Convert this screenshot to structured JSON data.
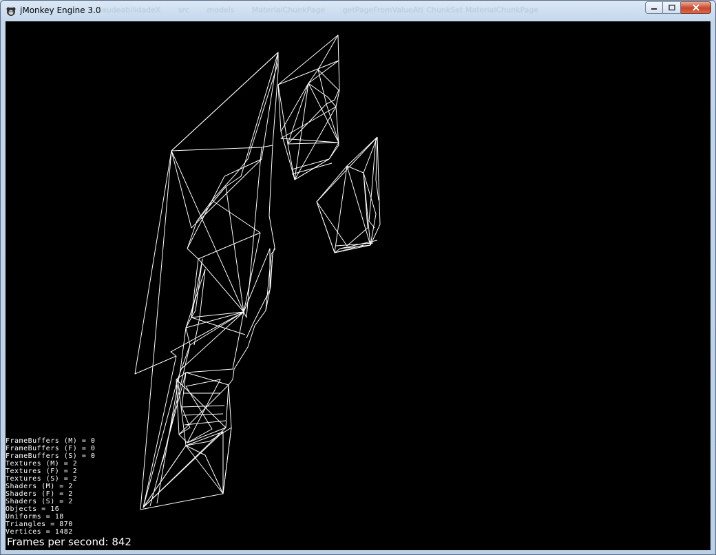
{
  "window": {
    "title": "jMonkey Engine 3.0",
    "app_icon": "jmonkey-icon",
    "background_breadcrumbs": [
      "SaudeabilidadeX",
      "src",
      "models",
      "MaterialChunkPage",
      "getPageFromValueAt( ChunkSet MaterialChunkPage"
    ],
    "controls": {
      "minimize_icon": "minimize-icon",
      "maximize_icon": "maximize-icon",
      "close_icon": "close-icon"
    }
  },
  "viewport": {
    "background": "#000000",
    "wire_color": "#ffffff"
  },
  "stats": [
    "FrameBuffers (M) = 0",
    "FrameBuffers (F) = 0",
    "FrameBuffers (S) = 0",
    "Textures (M) = 2",
    "Textures (F) = 2",
    "Textures (S) = 2",
    "Shaders (M) = 2",
    "Shaders (F) = 2",
    "Shaders (S) = 2",
    "Objects = 16",
    "Uniforms = 18",
    "Triangles = 870",
    "Vertices = 1482"
  ],
  "fps_label": "Frames per second: 842"
}
